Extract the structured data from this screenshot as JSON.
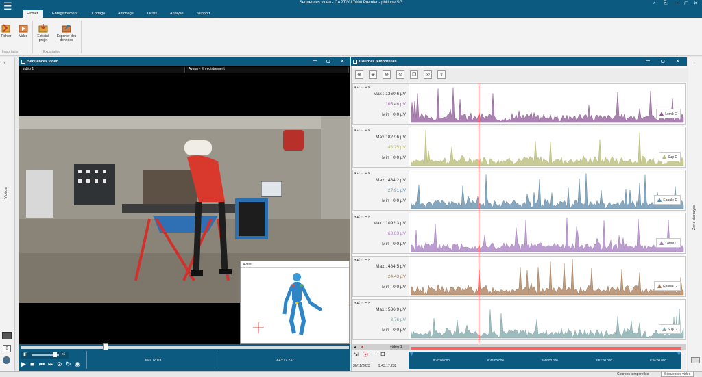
{
  "window": {
    "title": "Sequences vidéo - CAPTIV-L7000 Premier - philippe SG",
    "controls": [
      "?",
      "⎘",
      "—",
      "▢",
      "✕"
    ]
  },
  "ribbon": {
    "tabs": [
      "Fichier",
      "Enregistrement",
      "Codage",
      "Affichage",
      "Outils",
      "Analyse",
      "Support"
    ],
    "active_tab": "Fichier",
    "buttons": [
      {
        "label": "Fichier",
        "icon": "file-import-icon"
      },
      {
        "label": "Vidéo",
        "icon": "video-import-icon"
      },
      {
        "label": "Extrairé projet",
        "icon": "extract-project-icon"
      },
      {
        "label": "Exporter des données",
        "icon": "export-data-icon"
      }
    ],
    "groups": [
      "Importation",
      "Exportation"
    ]
  },
  "side": {
    "left_label": "Vidéos",
    "right_label": "Zone d'analyse"
  },
  "video_panel": {
    "title": "Séquences vidéo",
    "left_label": "vidéo 1",
    "right_label": "Avatar - Enregistrement",
    "avatar_title": "Avatar",
    "date": "30/11/2023",
    "time": "9:43:17.232",
    "speed": "x1"
  },
  "curves_panel": {
    "title": "Courbes temporelles",
    "rows": [
      {
        "max": "Max : 1360.6 µV",
        "avg": "105.46 µV",
        "min": "Min : 0.0 µV",
        "tag": "Lomb G",
        "color": "#8e5b95",
        "seed": 3
      },
      {
        "max": "Max : 827.6 µV",
        "avg": "43.75 µV",
        "min": "Min : 0.0 µV",
        "tag": "Sup D",
        "color": "#b6ba72",
        "seed": 7
      },
      {
        "max": "Max : 484.2 µV",
        "avg": "27.91 µV",
        "min": "Min : 0.0 µV",
        "tag": "Épaule D",
        "color": "#5d89a8",
        "seed": 11
      },
      {
        "max": "Max : 1092.3 µV",
        "avg": "63.83 µV",
        "min": "Min : 0.0 µV",
        "tag": "Lomb D",
        "color": "#a67cbf",
        "seed": 5
      },
      {
        "max": "Max : 484.5 µV",
        "avg": "24.43 µV",
        "min": "Min : 0.0 µV",
        "tag": "Épaule G",
        "color": "#a57a55",
        "seed": 13
      },
      {
        "max": "Max : 536.9 µV",
        "avg": "8.76 µV",
        "min": "Min : 0.0 µV",
        "tag": "Sup G",
        "color": "#7ea6a8",
        "seed": 17
      }
    ],
    "timeline": {
      "label": "vidéo 1",
      "date": "30/11/2023",
      "time": "9:43:17.232",
      "ticks": [
        "9:40:06.000",
        "9:44:00.000",
        "9:48:00.000",
        "9:52:00.000",
        "9:56:00.000"
      ]
    }
  },
  "status_tabs": [
    {
      "label": "Courbes temporelles",
      "active": false
    },
    {
      "label": "Séquences vidéo",
      "active": true
    }
  ]
}
